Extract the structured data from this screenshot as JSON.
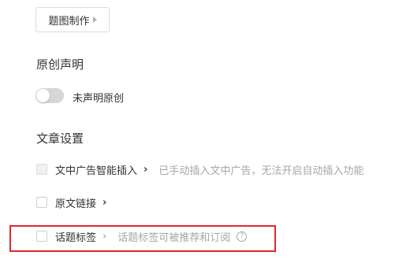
{
  "cover": {
    "button_label": "题图制作"
  },
  "original": {
    "title": "原创声明",
    "toggle_label": "未声明原创",
    "toggle_on": false
  },
  "article_settings": {
    "title": "文章设置",
    "items": [
      {
        "label": "文中广告智能插入",
        "chevron": "›",
        "hint": "已手动插入文中广告，无法开启自动插入功能",
        "disabled": true
      },
      {
        "label": "原文链接",
        "chevron": "›",
        "hint": "",
        "disabled": false
      },
      {
        "label": "话题标签",
        "chevron": "›",
        "hint": "话题标签可被推荐和订阅",
        "help": "?",
        "disabled": false,
        "highlighted": true
      }
    ]
  },
  "colors": {
    "highlight": "#e0282e",
    "text": "#333333",
    "hint": "#a6a6a6"
  }
}
